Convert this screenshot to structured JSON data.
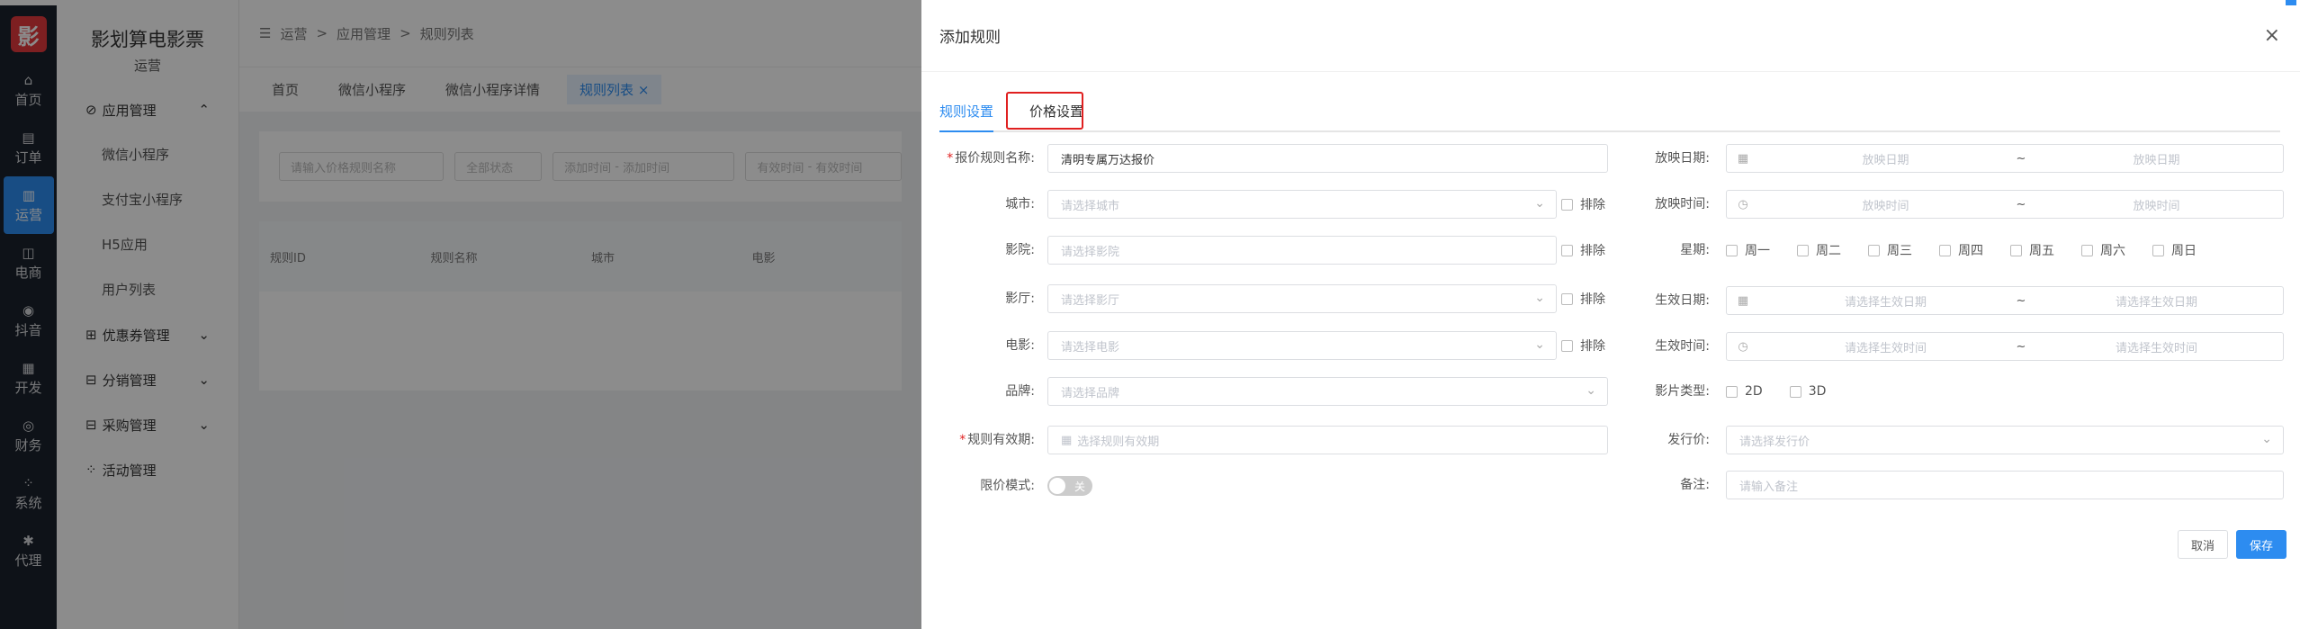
{
  "leftbar": {
    "logo": "影",
    "items": [
      {
        "icon": "⌂",
        "label": "首页"
      },
      {
        "icon": "▤",
        "label": "订单"
      },
      {
        "icon": "▥",
        "label": "运营"
      },
      {
        "icon": "◫",
        "label": "电商"
      },
      {
        "icon": "◉",
        "label": "抖音"
      },
      {
        "icon": "▦",
        "label": "开发"
      },
      {
        "icon": "◎",
        "label": "财务"
      },
      {
        "icon": "⁘",
        "label": "系统"
      },
      {
        "icon": "✱",
        "label": "代理"
      }
    ]
  },
  "sidemenu": {
    "title": "影划算电影票",
    "subtitle": "运营",
    "app_group": "应用管理",
    "app_items": [
      "微信小程序",
      "支付宝小程序",
      "H5应用",
      "用户列表"
    ],
    "groups": [
      "优惠券管理",
      "分销管理",
      "采购管理",
      "活动管理"
    ]
  },
  "main": {
    "breadcrumb": [
      "运营",
      "应用管理",
      "规则列表"
    ],
    "tabs": [
      "首页",
      "微信小程序",
      "微信小程序详情",
      "规则列表"
    ],
    "filters": [
      "请输入价格规则名称",
      "全部状态",
      "添加时间",
      "添加时间",
      "有效时间",
      "有效时间"
    ],
    "table_headers": [
      "规则ID",
      "规则名称",
      "城市",
      "电影"
    ]
  },
  "drawer": {
    "title": "添加规则",
    "close": "×",
    "tabs": [
      "规则设置",
      "价格设置"
    ],
    "left": {
      "name_label": "报价规则名称:",
      "name_value": "清明专属万达报价",
      "city_label": "城市:",
      "city_placeholder": "请选择城市",
      "cinema_label": "影院:",
      "cinema_placeholder": "请选择影院",
      "hall_label": "影厅:",
      "hall_placeholder": "请选择影厅",
      "movie_label": "电影:",
      "movie_placeholder": "请选择电影",
      "brand_label": "品牌:",
      "brand_placeholder": "请选择品牌",
      "validity_label": "规则有效期:",
      "validity_placeholder": "选择规则有效期",
      "limit_label": "限价模式:",
      "limit_switch": "关",
      "exclude": "排除"
    },
    "right": {
      "show_date_label": "放映日期:",
      "show_date_start": "放映日期",
      "show_date_end": "放映日期",
      "show_time_label": "放映时间:",
      "show_time_start": "放映时间",
      "show_time_end": "放映时间",
      "week_label": "星期:",
      "weekdays": [
        "周一",
        "周二",
        "周三",
        "周四",
        "周五",
        "周六",
        "周日"
      ],
      "eff_date_label": "生效日期:",
      "eff_date_start": "请选择生效日期",
      "eff_date_end": "请选择生效日期",
      "eff_time_label": "生效时间:",
      "eff_time_start": "请选择生效时间",
      "eff_time_end": "请选择生效时间",
      "film_type_label": "影片类型:",
      "film_types": [
        "2D",
        "3D"
      ],
      "price_label": "发行价:",
      "price_placeholder": "请选择发行价",
      "remark_label": "备注:",
      "remark_placeholder": "请输入备注",
      "range_sep": "~"
    },
    "buttons": {
      "cancel": "取消",
      "save": "保存"
    }
  }
}
